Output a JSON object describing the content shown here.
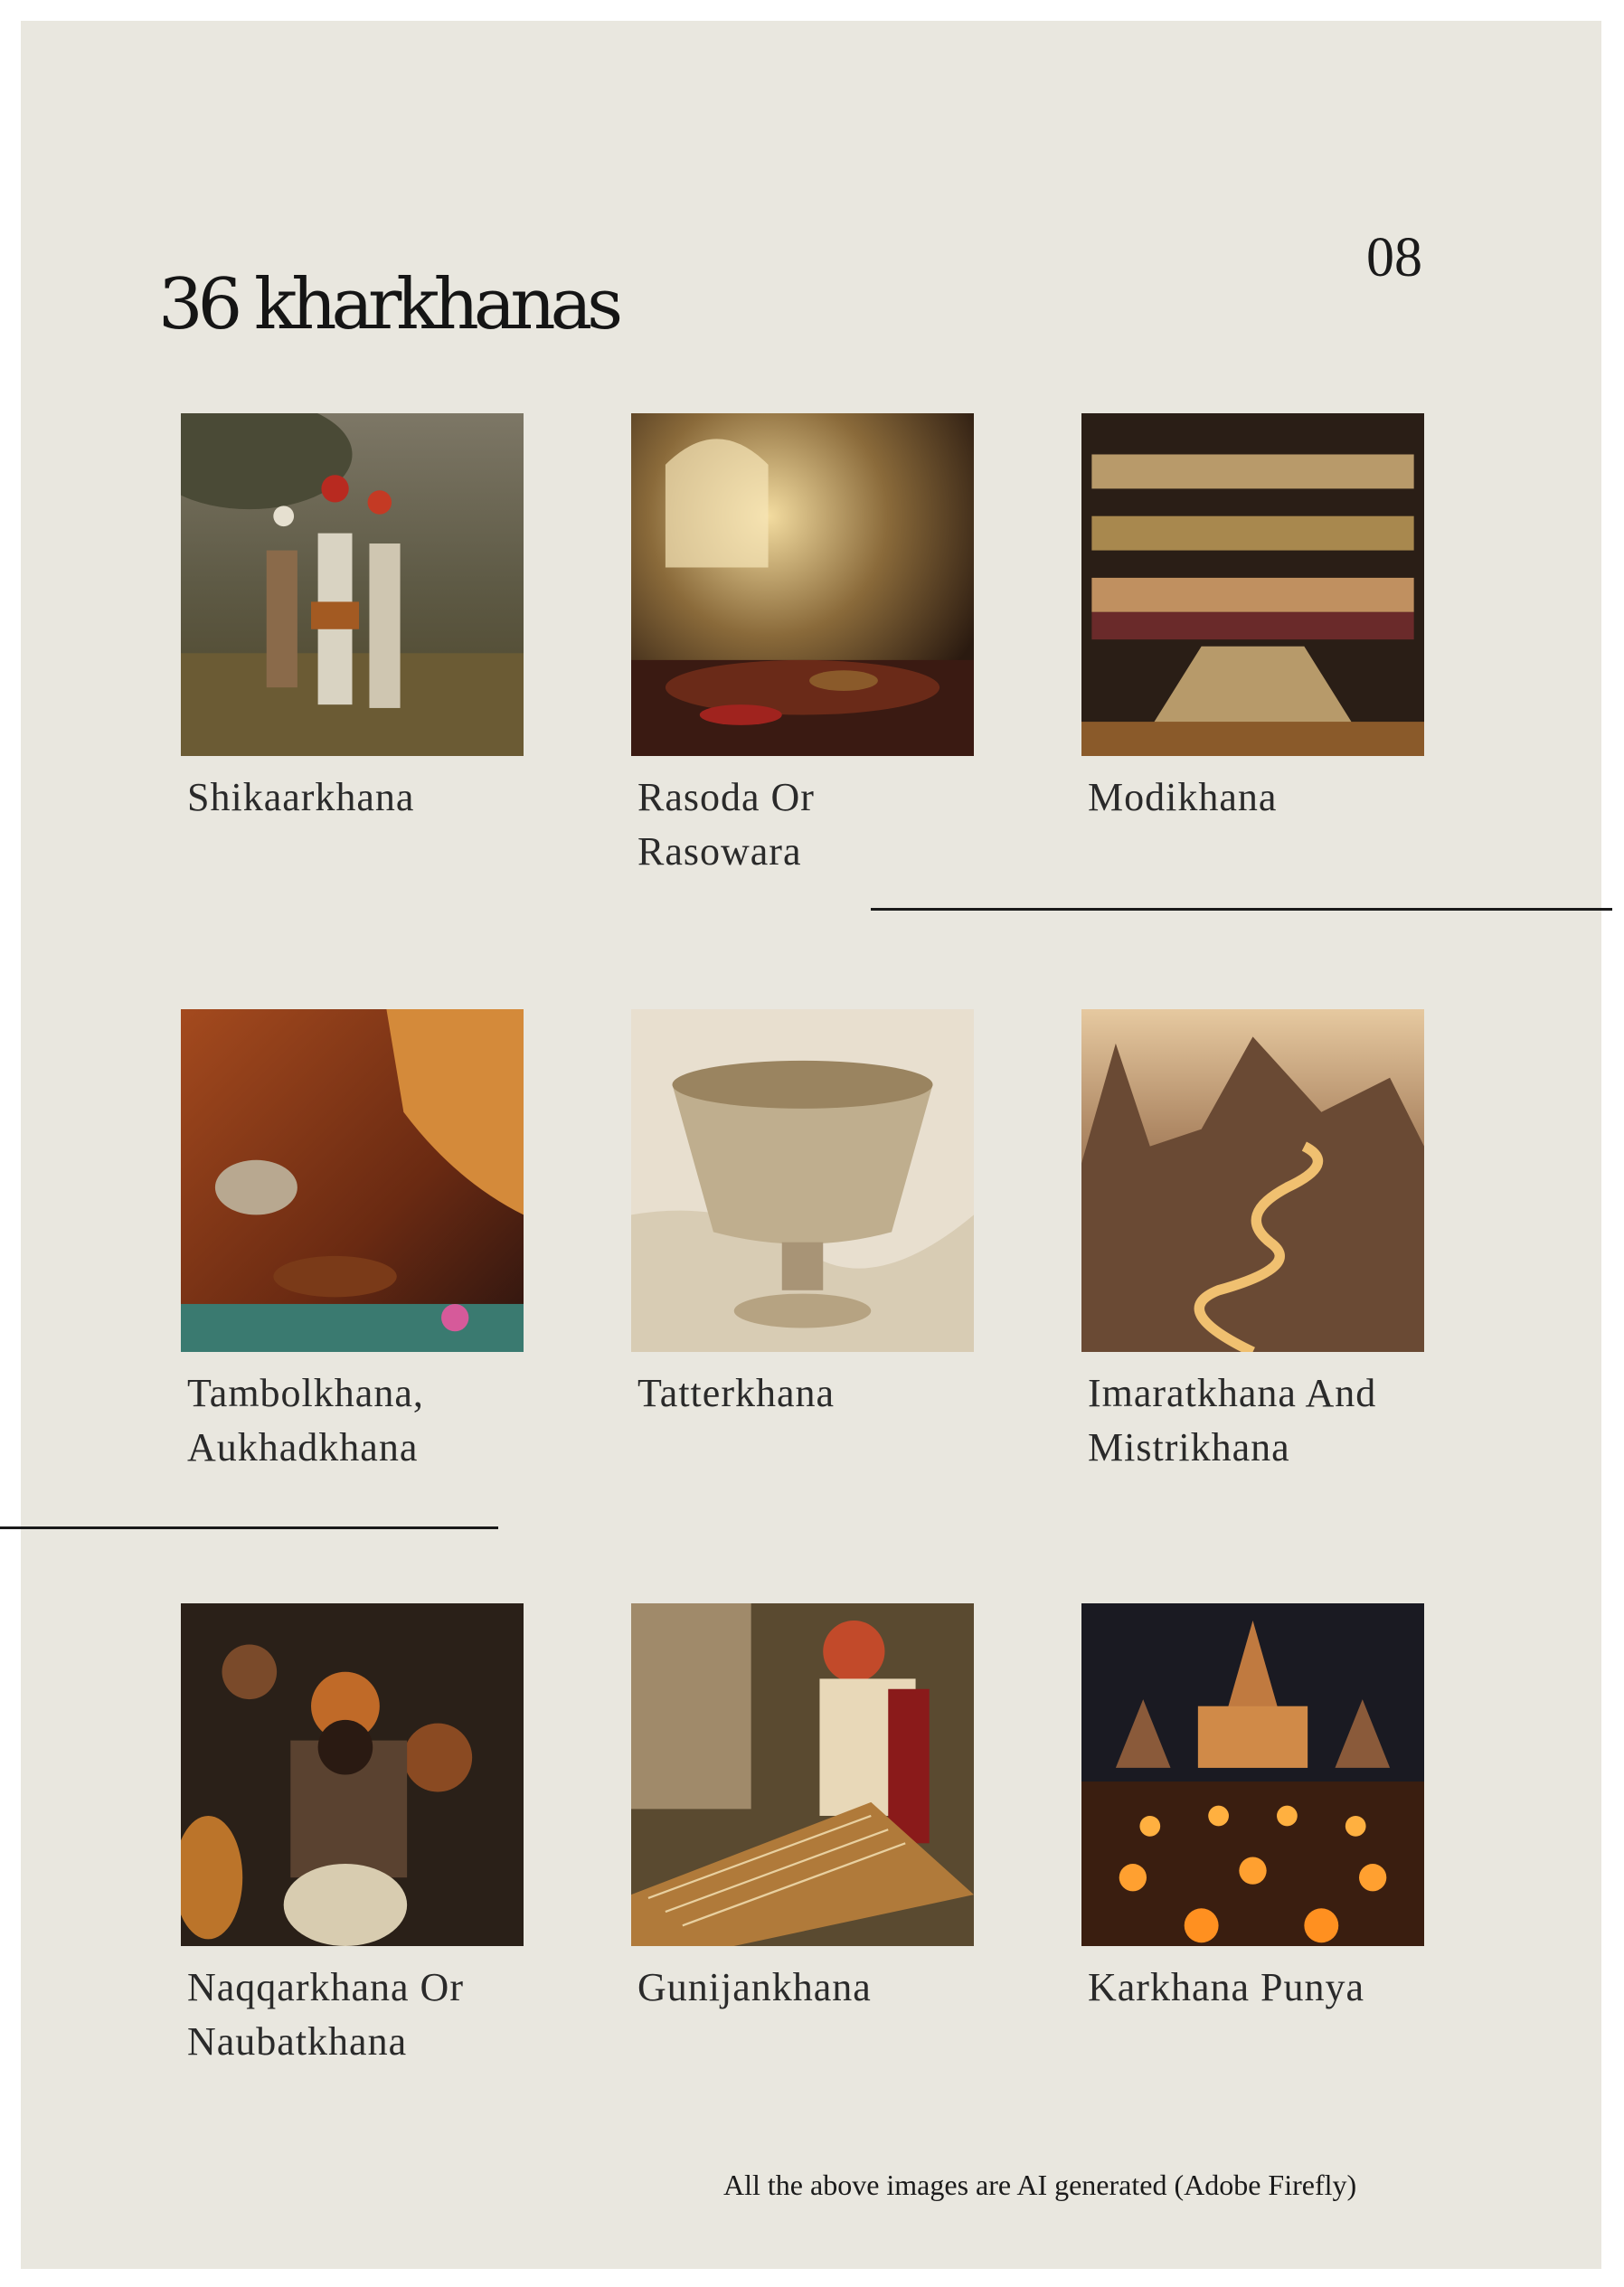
{
  "page": {
    "title": "36 kharkhanas",
    "number": "08",
    "footnote": "All the above images are AI generated (Adobe Firefly)",
    "background": "#e9e7df"
  },
  "items": [
    {
      "caption": "Shikaarkhana"
    },
    {
      "caption": "Rasoda Or Rasowara"
    },
    {
      "caption": "Modikhana"
    },
    {
      "caption": "Tambolkhana, Aukhadkhana"
    },
    {
      "caption": "Tatterkhana"
    },
    {
      "caption": "Imaratkhana And Mistrikhana"
    },
    {
      "caption": "Naqqarkhana Or Naubatkhana"
    },
    {
      "caption": "Gunijankhana"
    },
    {
      "caption": "Karkhana Punya"
    }
  ]
}
